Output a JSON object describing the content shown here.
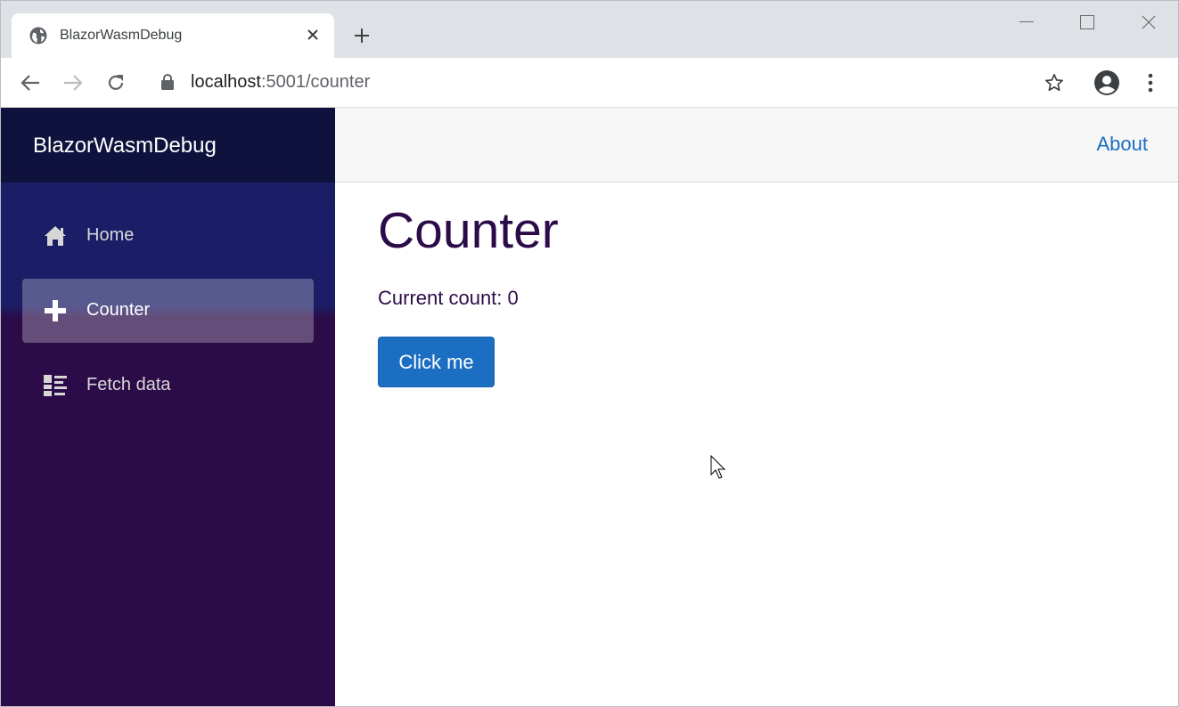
{
  "browser": {
    "tab_title": "BlazorWasmDebug",
    "url_host": "localhost",
    "url_rest": ":5001/counter"
  },
  "sidebar": {
    "brand": "BlazorWasmDebug",
    "items": [
      {
        "label": "Home",
        "icon": "home-icon",
        "active": false
      },
      {
        "label": "Counter",
        "icon": "plus-icon",
        "active": true
      },
      {
        "label": "Fetch data",
        "icon": "list-icon",
        "active": false
      }
    ]
  },
  "top_row": {
    "about": "About"
  },
  "main": {
    "title": "Counter",
    "count_label": "Current count: 0",
    "button_label": "Click me"
  },
  "colors": {
    "accent": "#1b6ec2",
    "sidebar_top": "#1b1e66",
    "sidebar_bottom": "#2c0c48",
    "heading": "#2c0c48"
  }
}
